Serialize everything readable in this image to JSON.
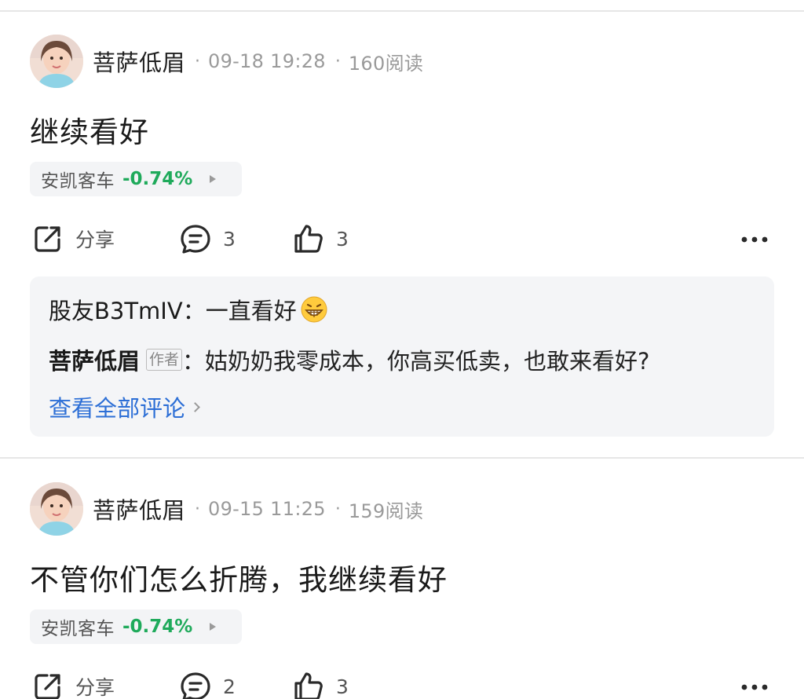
{
  "posts": [
    {
      "author": "菩萨低眉",
      "time": "09-18 19:28",
      "views": "160阅读",
      "content": "继续看好",
      "stock": {
        "name": "安凯客车",
        "change": "-0.74%"
      },
      "actions": {
        "share_label": "分享",
        "comment_count": "3",
        "like_count": "3"
      },
      "comments": {
        "line1": {
          "user": "股友B3TmIV",
          "sep": "：",
          "text": "一直看好"
        },
        "line2": {
          "user": "菩萨低眉",
          "badge": "作者",
          "sep": "：",
          "text": "姑奶奶我零成本，你高买低卖，也敢来看好?"
        },
        "view_all": "查看全部评论"
      }
    },
    {
      "author": "菩萨低眉",
      "time": "09-15 11:25",
      "views": "159阅读",
      "content": "不管你们怎么折腾，我继续看好",
      "stock": {
        "name": "安凯客车",
        "change": "-0.74%"
      },
      "actions": {
        "share_label": "分享",
        "comment_count": "2",
        "like_count": "3"
      }
    }
  ],
  "meta_separator": "·",
  "colors": {
    "stock_down": "#1faa5b",
    "link": "#2d6fd6",
    "muted": "#9a9a9a"
  },
  "icons": [
    "share-icon",
    "comment-icon",
    "like-icon",
    "more-icon",
    "grin-emoji-icon",
    "chevron-right-icon"
  ]
}
